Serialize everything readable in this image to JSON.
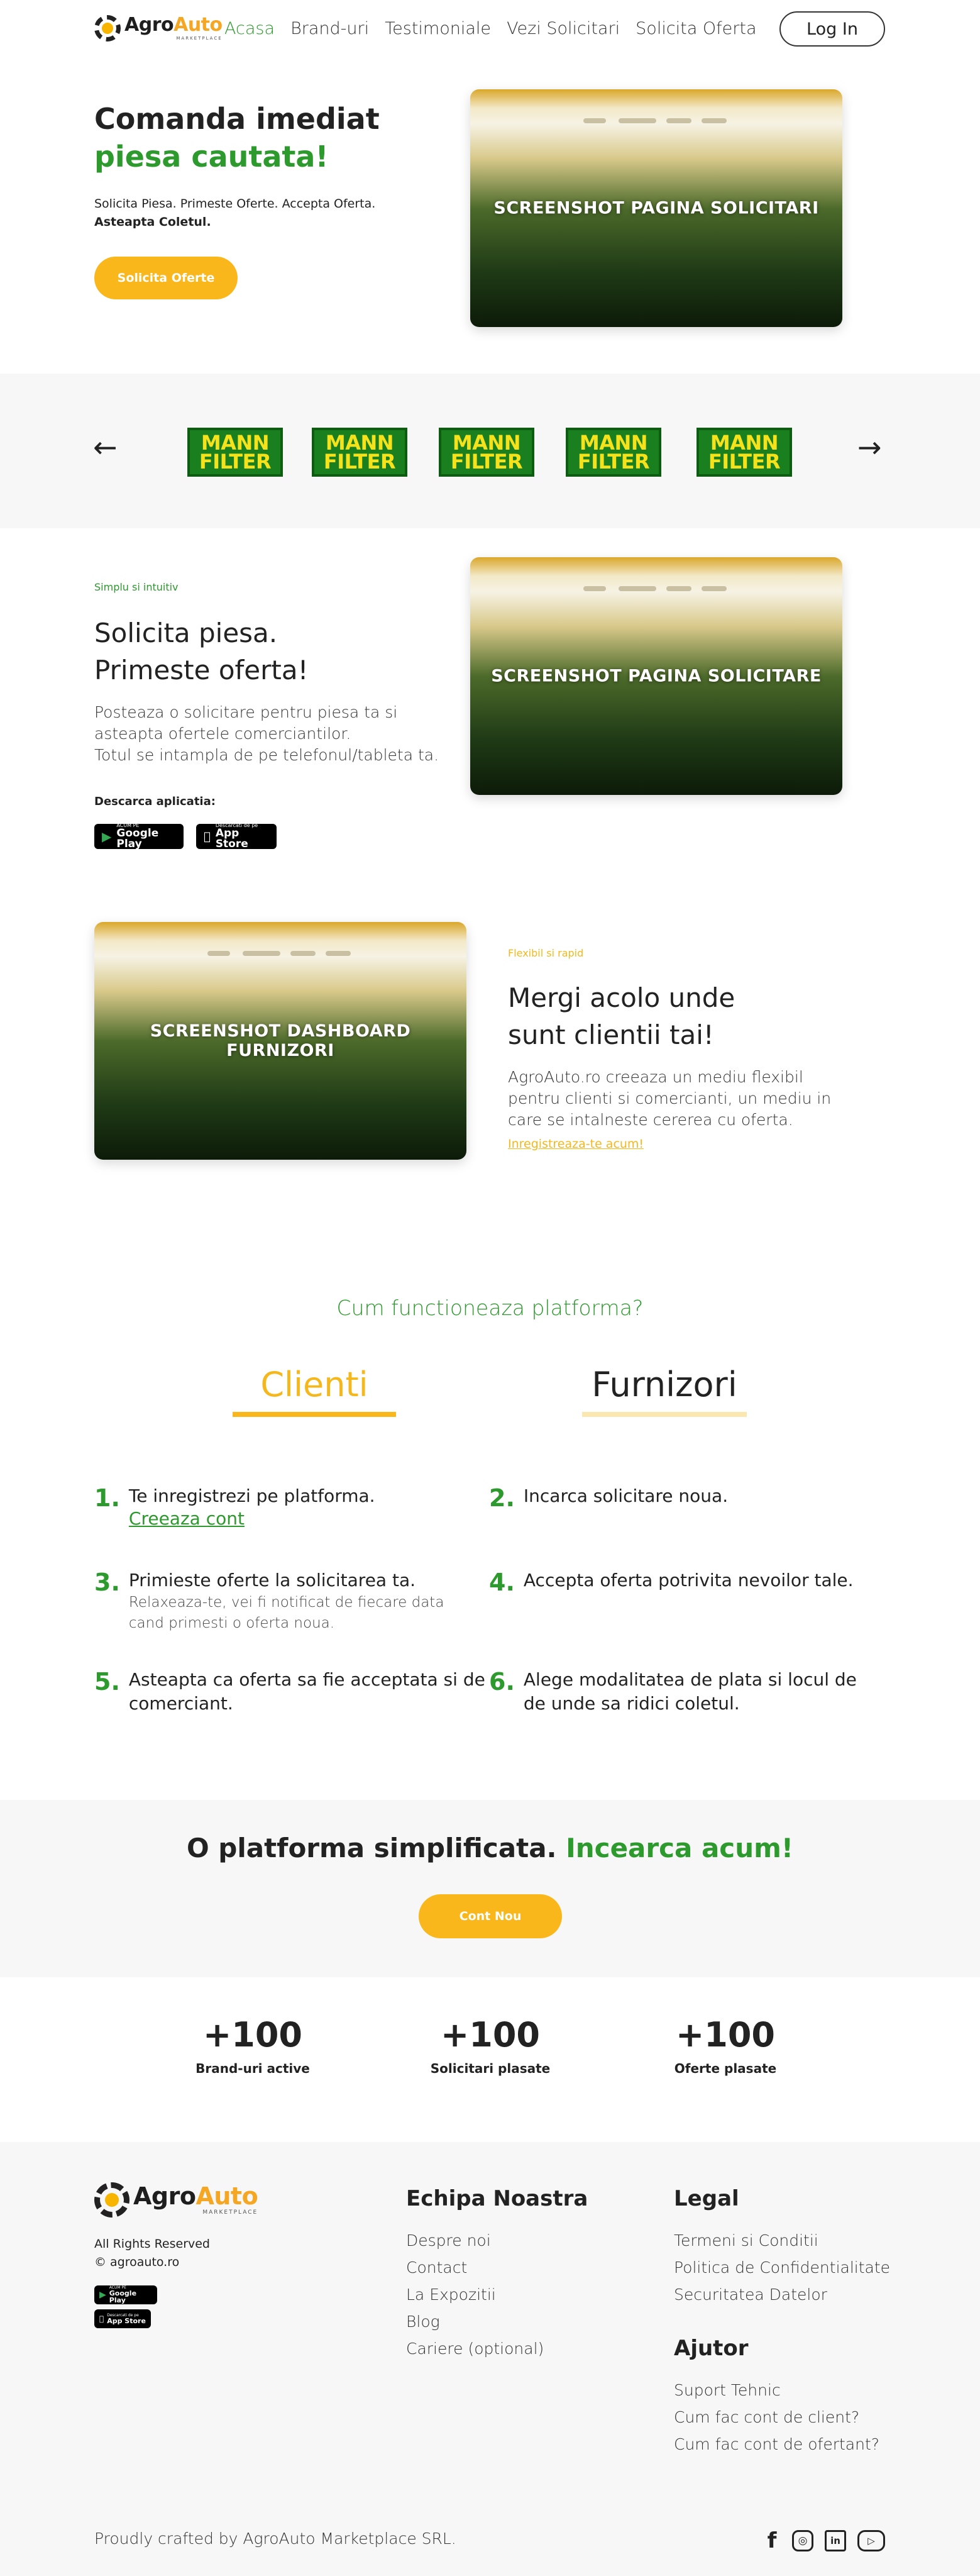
{
  "header": {
    "logo": {
      "part1": "Agro",
      "part2": "Auto",
      "sub": "MARKETPLACE"
    },
    "nav": [
      "Acasa",
      "Brand-uri",
      "Testimoniale",
      "Vezi Solicitari",
      "Solicita Oferta"
    ],
    "login": "Log In"
  },
  "hero": {
    "title_line1": "Comanda imediat",
    "title_line2": "piesa cautata!",
    "text": "Solicita Piesa. Primeste Oferte. Accepta Oferta.",
    "text_bold": "Asteapta Coletul.",
    "button": "Solicita Oferte",
    "screenshot_label": "SCREENSHOT PAGINA SOLICITARI"
  },
  "brands": {
    "items": [
      {
        "line1": "MANN",
        "line2": "FILTER"
      },
      {
        "line1": "MANN",
        "line2": "FILTER"
      },
      {
        "line1": "MANN",
        "line2": "FILTER"
      },
      {
        "line1": "MANN",
        "line2": "FILTER"
      },
      {
        "line1": "MANN",
        "line2": "FILTER"
      }
    ],
    "prev_icon": "arrow-left",
    "next_icon": "arrow-right"
  },
  "feature1": {
    "eyebrow": "Simplu si intuitiv",
    "title_line1": "Solicita piesa.",
    "title_line2": "Primeste oferta!",
    "para_line1": "Posteaza o solicitare pentru piesa ta si",
    "para_line2": "asteapta ofertele comerciantilor.",
    "para_line3": "Totul se intampla de pe telefonul/tableta ta.",
    "download_label": "Descarca aplicatia:",
    "google_small": "ACUM PE",
    "google_big": "Google Play",
    "apple_small": "Descarcati de pe",
    "apple_big": "App Store",
    "screenshot_label": "SCREENSHOT PAGINA SOLICITARE"
  },
  "feature2": {
    "eyebrow": "Flexibil si rapid",
    "title_line1": "Mergi acolo unde",
    "title_line2": "sunt clientii tai!",
    "para_line1": "AgroAuto.ro creeaza un mediu flexibil",
    "para_line2": "pentru clienti si comercianti, un mediu in",
    "para_line3": "care se intalneste cererea cu oferta.",
    "link": "Inregistreaza-te acum!",
    "screenshot_line1": "SCREENSHOT DASHBOARD",
    "screenshot_line2": "FURNIZORI"
  },
  "how": {
    "title": "Cum functioneaza platforma?",
    "tabs": [
      "Clienti",
      "Furnizori"
    ],
    "steps": [
      {
        "num": "1.",
        "title": "Te inregistrezi pe platforma.",
        "link": "Creeaza cont"
      },
      {
        "num": "2.",
        "title": "Incarca solicitare noua."
      },
      {
        "num": "3.",
        "title": "Primieste oferte la solicitarea ta.",
        "sub1": "Relaxeaza-te, vei fi notificat de fiecare data",
        "sub2": "cand primesti o oferta noua."
      },
      {
        "num": "4.",
        "title": "Accepta oferta potrivita nevoilor tale."
      },
      {
        "num": "5.",
        "title1": "Asteapta ca oferta sa fie acceptata si de",
        "title2": "comerciant."
      },
      {
        "num": "6.",
        "title1": "Alege modalitatea de plata si locul de",
        "title2": "de unde sa ridici coletul."
      }
    ]
  },
  "cta": {
    "text": "O platforma simplificata.",
    "highlight": "Incearca acum!",
    "button": "Cont Nou"
  },
  "stats": [
    {
      "value": "+100",
      "label": "Brand-uri active"
    },
    {
      "value": "+100",
      "label": "Solicitari plasate"
    },
    {
      "value": "+100",
      "label": "Oferte plasate"
    }
  ],
  "footer": {
    "rights": "All Rights Reserved",
    "copy": "© agroauto.ro",
    "team_title": "Echipa Noastra",
    "team_links": [
      "Despre noi",
      "Contact",
      "La Expozitii",
      "Blog",
      "Cariere (optional)"
    ],
    "legal_title": "Legal",
    "legal_links": [
      "Termeni si Conditii",
      "Politica de Confidentialitate",
      "Securitatea Datelor"
    ],
    "help_title": "Ajutor",
    "help_links": [
      "Suport Tehnic",
      "Cum fac cont de client?",
      "Cum fac cont de ofertant?"
    ],
    "crafted": "Proudly crafted by AgroAuto Marketplace SRL.",
    "social": {
      "facebook": "f",
      "instagram": "◎",
      "linkedin": "in",
      "youtube": "▷"
    }
  },
  "colors": {
    "green": "#2c9a2c",
    "yellow": "#f9b71c",
    "band": "#f7f7f7"
  }
}
